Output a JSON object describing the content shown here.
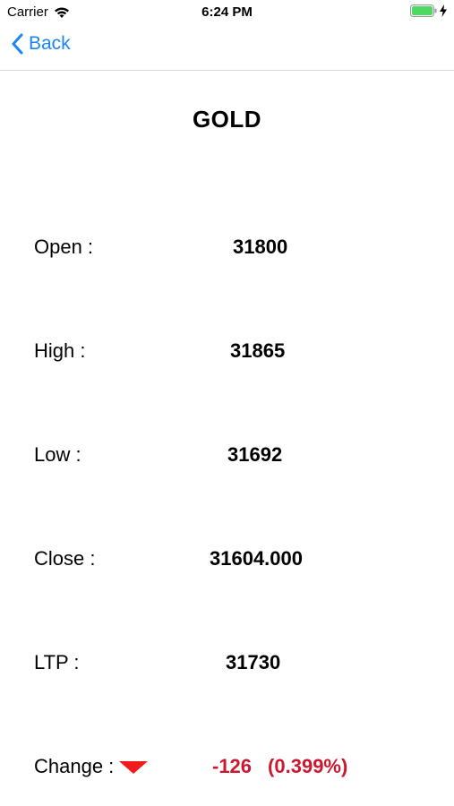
{
  "status_bar": {
    "carrier": "Carrier",
    "time": "6:24 PM",
    "icons": [
      "wifi-icon",
      "battery-icon",
      "charging-icon"
    ],
    "battery_color": "#4cd964"
  },
  "nav": {
    "back_label": "Back",
    "back_icon": "chevron-left-icon",
    "accent_color": "#1a86f3"
  },
  "title": "GOLD",
  "rows": {
    "open": {
      "label": "Open  :",
      "value": "31800"
    },
    "high": {
      "label": "High  :",
      "value": "31865"
    },
    "low": {
      "label": "Low  :",
      "value": "31692"
    },
    "close": {
      "label": "Close  :",
      "value": "31604.000"
    },
    "ltp": {
      "label": "LTP  :",
      "value": "31730"
    },
    "change": {
      "label": "Change  :",
      "direction_icon": "down-arrow-icon",
      "value": "-126",
      "percent": "(0.399%)",
      "color": "#cc1730"
    }
  }
}
